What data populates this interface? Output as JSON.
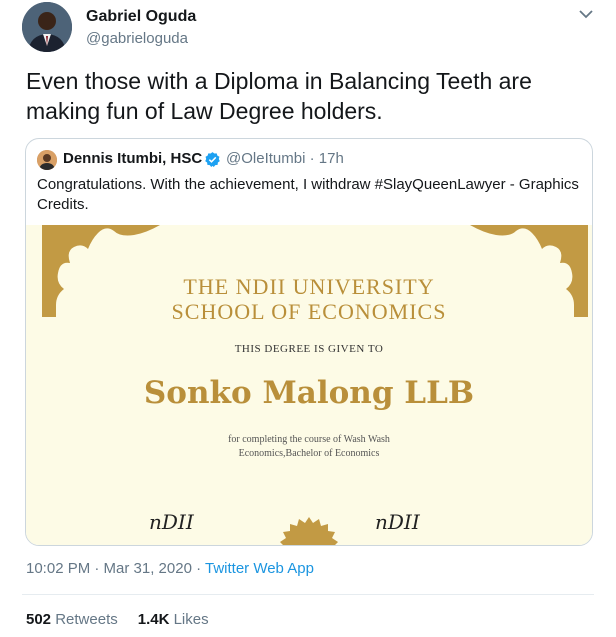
{
  "author": {
    "name": "Gabriel Oguda",
    "handle": "@gabrieloguda"
  },
  "tweet": {
    "text": "Even those with a Diploma in Balancing Teeth are making fun of Law Degree holders."
  },
  "quote": {
    "name": "Dennis Itumbi, HSC",
    "handle": "@OleItumbi",
    "separator": "·",
    "time": "17h",
    "text": "Congratulations. With the achievement, I withdraw #SlayQueenLawyer - Graphics Credits.",
    "certificate": {
      "title_line1": "THE NDII UNIVERSITY",
      "title_line2": "SCHOOL OF ECONOMICS",
      "given_to": "THIS DEGREE IS GIVEN TO",
      "recipient": "Sonko Malong LLB",
      "description_line1": "for completing the course of Wash Wash",
      "description_line2": "Economics,Bachelor of Economics",
      "signature_left": "nDII",
      "signature_right": "nDII"
    }
  },
  "meta": {
    "time": "10:02 PM · Mar 31, 2020 · ",
    "app": "Twitter Web App"
  },
  "stats": {
    "retweets_count": "502",
    "retweets_label": "Retweets",
    "likes_count": "1.4K",
    "likes_label": "Likes"
  },
  "colors": {
    "link": "#1b95e0",
    "gold": "#b98f3a",
    "muted": "#657786"
  },
  "icons": {
    "menu": "chevron-down-icon",
    "verified": "verified-badge-icon"
  }
}
